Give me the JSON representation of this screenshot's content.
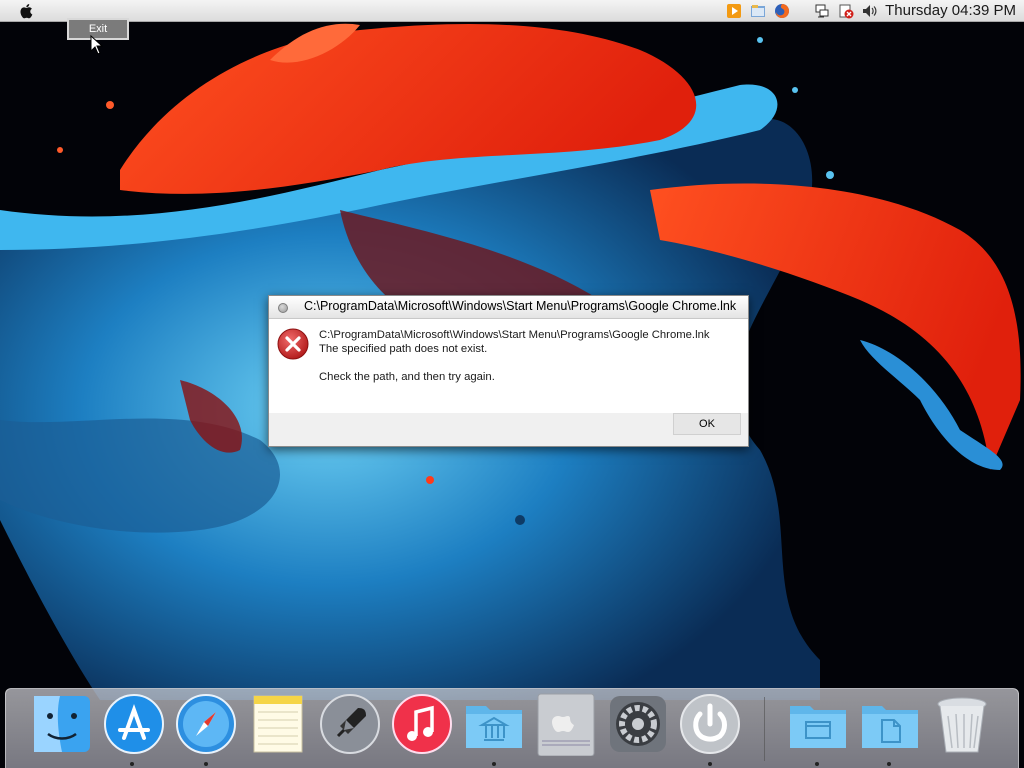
{
  "menubar": {
    "clock": "Thursday 04:39 PM",
    "tray_icons": [
      "media-player-icon",
      "file-manager-icon",
      "firefox-icon",
      "network-icon",
      "security-alert-icon",
      "volume-icon"
    ]
  },
  "exit_button": {
    "label": "Exit"
  },
  "dialog": {
    "title": "C:\\ProgramData\\Microsoft\\Windows\\Start Menu\\Programs\\Google Chrome.lnk",
    "line1": "C:\\ProgramData\\Microsoft\\Windows\\Start Menu\\Programs\\Google Chrome.lnk",
    "line2": "The specified path does not exist.",
    "line3": "Check the path, and then try again.",
    "ok_label": "OK",
    "icon": "error-icon"
  },
  "dock": {
    "items": [
      "finder-icon",
      "app-store-icon",
      "safari-icon",
      "notes-icon",
      "launchpad-icon",
      "itunes-icon",
      "applications-folder-icon",
      "mac-pro-icon",
      "system-preferences-icon",
      "power-icon",
      "desktop-folder-icon",
      "documents-folder-icon",
      "trash-icon"
    ]
  }
}
